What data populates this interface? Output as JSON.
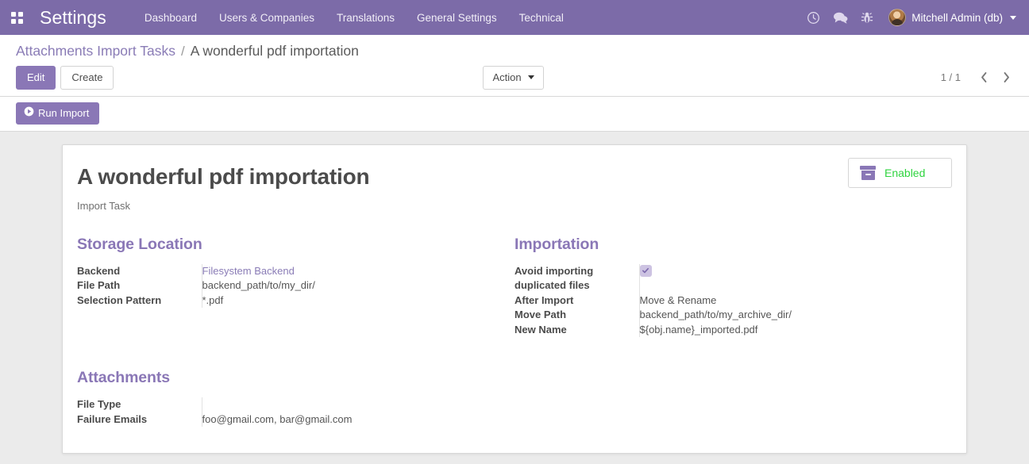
{
  "navbar": {
    "apps_icon": "apps-grid-icon",
    "brand": "Settings",
    "menu_items": [
      {
        "label": "Dashboard"
      },
      {
        "label": "Users & Companies"
      },
      {
        "label": "Translations"
      },
      {
        "label": "General Settings"
      },
      {
        "label": "Technical"
      }
    ],
    "icons": [
      {
        "name": "clock-icon"
      },
      {
        "name": "chat-icon"
      },
      {
        "name": "bug-icon"
      }
    ],
    "user": "Mitchell Admin (db)",
    "bg_color": "#7c6ba8"
  },
  "control_panel": {
    "breadcrumb": {
      "parent": "Attachments Import Tasks",
      "separator": "/",
      "current": "A wonderful pdf importation"
    },
    "edit_label": "Edit",
    "create_label": "Create",
    "action_label": "Action",
    "pager": {
      "count": "1 / 1",
      "prev_icon": "chevron-left-icon",
      "next_icon": "chevron-right-icon"
    }
  },
  "statusbar": {
    "run_import_label": "Run Import",
    "run_import_icon": "play-circle-icon"
  },
  "sheet": {
    "title": "A wonderful pdf importation",
    "subtitle": "Import Task",
    "stat_button": {
      "icon": "archive-icon",
      "label": "Enabled",
      "label_color": "#2fd43f"
    },
    "groups": [
      {
        "title": "Storage Location",
        "fields": [
          {
            "label": "Backend",
            "value": "Filesystem Backend",
            "type": "link"
          },
          {
            "label": "File Path",
            "value": "backend_path/to/my_dir/",
            "type": "text"
          },
          {
            "label": "Selection Pattern",
            "value": "*.pdf",
            "type": "text"
          }
        ]
      },
      {
        "title": "Importation",
        "fields": [
          {
            "label": "Avoid importing duplicated files",
            "value": "",
            "type": "checkbox",
            "checked": true
          },
          {
            "label": "After Import",
            "value": "Move & Rename",
            "type": "text"
          },
          {
            "label": "Move Path",
            "value": "backend_path/to/my_archive_dir/",
            "type": "text"
          },
          {
            "label": "New Name",
            "value": "${obj.name}_imported.pdf",
            "type": "text"
          }
        ]
      }
    ],
    "attachments": {
      "title": "Attachments",
      "fields": [
        {
          "label": "File Type",
          "value": "",
          "type": "text"
        },
        {
          "label": "Failure Emails",
          "value": "foo@gmail.com, bar@gmail.com",
          "type": "text"
        }
      ]
    }
  }
}
